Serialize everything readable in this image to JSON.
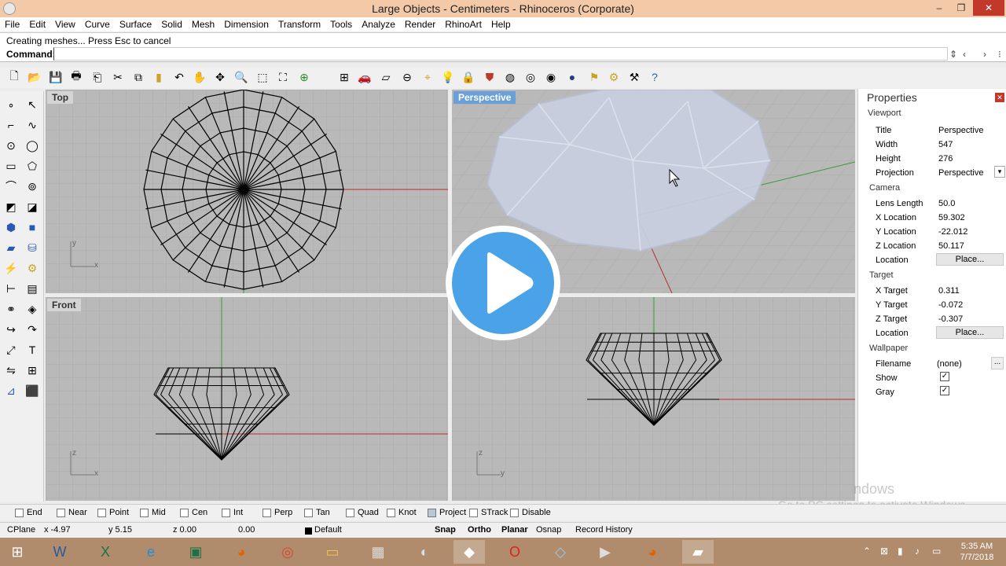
{
  "window": {
    "title": "Large Objects - Centimeters - Rhinoceros (Corporate)",
    "controls": [
      "–",
      "❐",
      "✕"
    ]
  },
  "menu": [
    "File",
    "Edit",
    "View",
    "Curve",
    "Surface",
    "Solid",
    "Mesh",
    "Dimension",
    "Transform",
    "Tools",
    "Analyze",
    "Render",
    "RhinoArt",
    "Help"
  ],
  "command": {
    "history": "Creating meshes... Press Esc to cancel",
    "label": "Command:",
    "value": ""
  },
  "viewports": {
    "top": "Top",
    "perspective": "Perspective",
    "front": "Front"
  },
  "axes": {
    "x": "x",
    "y": "y",
    "z": "z"
  },
  "properties": {
    "title": "Properties",
    "sections": {
      "viewport": "Viewport",
      "camera": "Camera",
      "target": "Target",
      "wallpaper": "Wallpaper"
    },
    "title_label": "Title",
    "title_value": "Perspective",
    "width_label": "Width",
    "width_value": "547",
    "height_label": "Height",
    "height_value": "276",
    "projection_label": "Projection",
    "projection_value": "Perspective",
    "lens_label": "Lens Length",
    "lens_value": "50.0",
    "xloc_label": "X Location",
    "xloc_value": "59.302",
    "yloc_label": "Y Location",
    "yloc_value": "-22.012",
    "zloc_label": "Z Location",
    "zloc_value": "50.117",
    "location_label": "Location",
    "place_button": "Place...",
    "xt_label": "X Target",
    "xt_value": "0.311",
    "yt_label": "Y Target",
    "yt_value": "-0.072",
    "zt_label": "Z Target",
    "zt_value": "-0.307",
    "filename_label": "Filename",
    "filename_value": "(none)",
    "browse_button": "...",
    "show_label": "Show",
    "gray_label": "Gray",
    "show_checked": true,
    "gray_checked": true
  },
  "osnap": [
    "End",
    "Near",
    "Point",
    "Mid",
    "Cen",
    "Int",
    "Perp",
    "Tan",
    "Quad",
    "Knot",
    "Project",
    "STrack",
    "Disable"
  ],
  "status": {
    "cplane": "CPlane",
    "x": "x -4.97",
    "y": "y 5.15",
    "z": "z 0.00",
    "dist": "0.00",
    "layer": "Default",
    "snap": "Snap",
    "ortho": "Ortho",
    "planar": "Planar",
    "osnap": "Osnap",
    "record": "Record History"
  },
  "watermark": {
    "line1": "ndows",
    "line2": "Go to PC settings to activate Windows."
  },
  "taskbar": {
    "time": "5:35 AM",
    "date": "7/7/2018"
  },
  "colors": {
    "accent": "#4aa3e8",
    "titlebar": "#f3c9a7",
    "taskbar": "#b08c6d"
  }
}
